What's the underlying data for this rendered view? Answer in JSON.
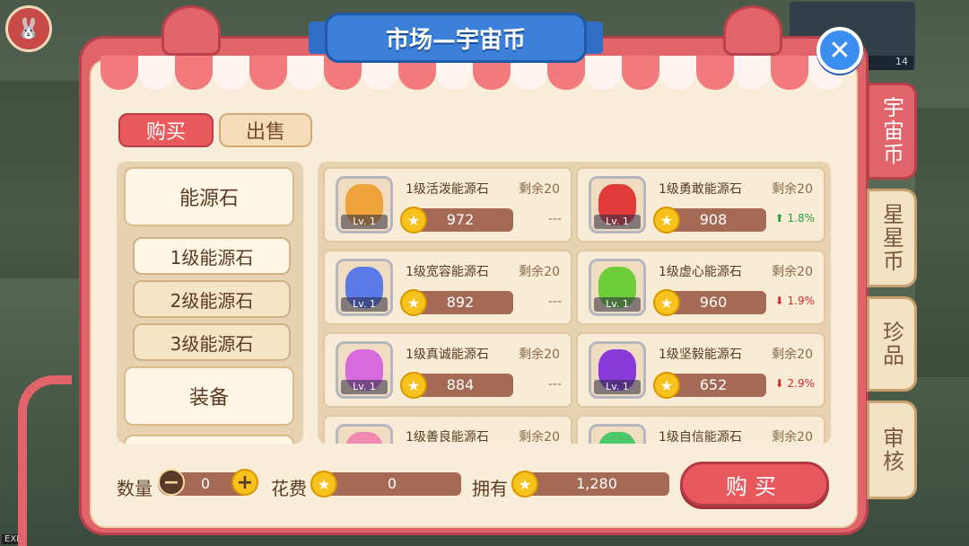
{
  "title": "市场—宇宙币",
  "close_icon": "close-icon",
  "hud": {
    "count": "14",
    "exp_label": "EXP"
  },
  "tabs": {
    "buy": "购买",
    "sell": "出售"
  },
  "side_tabs": [
    {
      "label": "宇宙币",
      "active": true
    },
    {
      "label": "星星币",
      "active": false
    },
    {
      "label": "珍品",
      "active": false
    },
    {
      "label": "审核",
      "active": false
    }
  ],
  "categories": {
    "energy_stone": "能源石",
    "level1": "1级能源石",
    "level2": "2级能源石",
    "level3": "3级能源石",
    "equipment": "装备"
  },
  "items": [
    {
      "name": "1级活泼能源石",
      "remain": "剩余20",
      "price": "972",
      "trend": "---",
      "trend_dir": "flat",
      "level": "Lv. 1",
      "color": "#f0a23a"
    },
    {
      "name": "1级勇敢能源石",
      "remain": "剩余20",
      "price": "908",
      "trend": "1.8%",
      "trend_dir": "up",
      "level": "Lv. 1",
      "color": "#e03a3a"
    },
    {
      "name": "1级宽容能源石",
      "remain": "剩余20",
      "price": "892",
      "trend": "---",
      "trend_dir": "flat",
      "level": "Lv. 1",
      "color": "#5a7ae8"
    },
    {
      "name": "1级虚心能源石",
      "remain": "剩余20",
      "price": "960",
      "trend": "1.9%",
      "trend_dir": "down",
      "level": "Lv. 1",
      "color": "#6ccf3a"
    },
    {
      "name": "1级真诚能源石",
      "remain": "剩余20",
      "price": "884",
      "trend": "---",
      "trend_dir": "flat",
      "level": "Lv. 1",
      "color": "#d86adf"
    },
    {
      "name": "1级坚毅能源石",
      "remain": "剩余20",
      "price": "652",
      "trend": "2.9%",
      "trend_dir": "down",
      "level": "Lv. 1",
      "color": "#8a3ad8"
    },
    {
      "name": "1级善良能源石",
      "remain": "剩余20",
      "price": "",
      "trend": "",
      "trend_dir": "flat",
      "level": "",
      "color": "#f08ab0"
    },
    {
      "name": "1级自信能源石",
      "remain": "剩余20",
      "price": "",
      "trend": "",
      "trend_dir": "flat",
      "level": "",
      "color": "#4ac86a"
    }
  ],
  "footer": {
    "qty_label": "数量",
    "qty_value": "0",
    "cost_label": "花费",
    "cost_value": "0",
    "own_label": "拥有",
    "own_value": "1,280",
    "buy_button": "购买"
  },
  "colors": {
    "accent": "#e0646a",
    "coin": "#f7c21b",
    "price_bar": "#a46a55",
    "panel": "#f8edd9"
  }
}
